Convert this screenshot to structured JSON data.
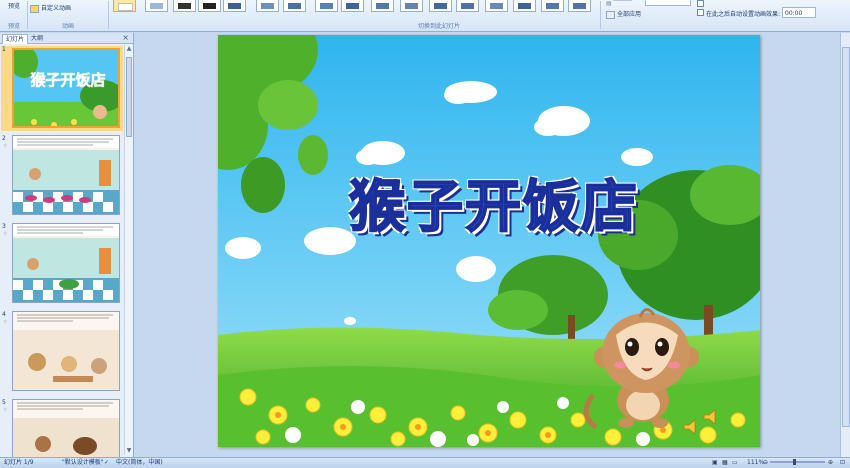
{
  "ribbon": {
    "preview_label": "预览",
    "custom_animation_label": "自定义动画",
    "group_preview": "预览",
    "group_animation": "动画",
    "group_transition": "切换到此幻灯片",
    "apply_all_label": "全部应用",
    "auto_after_label": "在此之后自动设置动画效果:",
    "auto_after_value": "00:00"
  },
  "pane": {
    "tab_slides": "幻灯片",
    "tab_outline": "大纲",
    "close_glyph": "×",
    "slide_numbers": [
      "1",
      "2",
      "3",
      "4",
      "5"
    ]
  },
  "slide": {
    "title": "猴子开饭店",
    "sky_color": "#4cc3f2",
    "grass_color": "#5cc531",
    "title_color": "#2f55d8"
  },
  "status": {
    "slide_info": "幻灯片 1/9",
    "theme": "\"默认设计模板\"",
    "language": "中文(简体，中国)",
    "zoom": "111%"
  },
  "icons": [
    "play-icon",
    "star-icon",
    "close-icon",
    "monkey-icon",
    "speaker-icon"
  ]
}
